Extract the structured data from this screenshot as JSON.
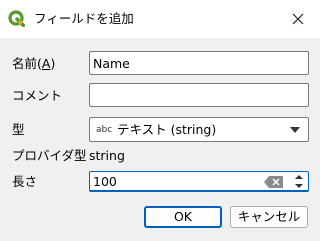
{
  "window": {
    "title": "フィールドを追加",
    "app_icon": "qgis-logo-icon",
    "close_icon": "close-icon"
  },
  "form": {
    "name": {
      "label": "名前(",
      "mnemonic": "A",
      "label_end": ")",
      "value": "Name"
    },
    "comment": {
      "label": "コメント",
      "value": ""
    },
    "type": {
      "label": "型",
      "type_badge": "abc",
      "selected": "テキスト (string)",
      "dropdown_icon": "chevron-down-icon"
    },
    "provider_type": {
      "label": "プロバイダ型",
      "value": "string"
    },
    "length": {
      "label": "長さ",
      "value": "100",
      "clear_icon": "clear-icon",
      "up_icon": "spin-up-icon",
      "down_icon": "spin-down-icon"
    }
  },
  "buttons": {
    "ok": "OK",
    "cancel": "キャンセル"
  },
  "colors": {
    "accent": "#0060c0",
    "qgis_green": "#589632",
    "qgis_yellow": "#ee7913"
  }
}
